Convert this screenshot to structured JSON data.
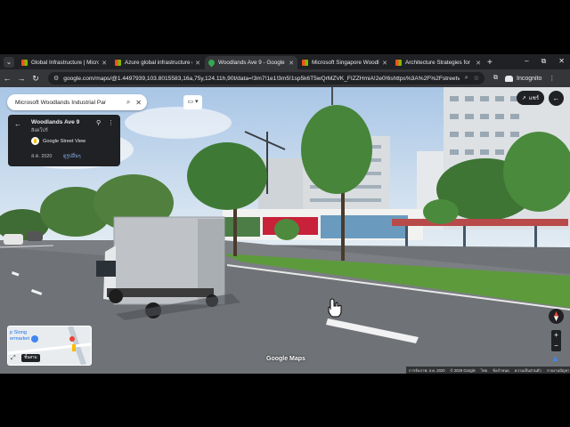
{
  "browser": {
    "tabs": [
      {
        "label": "Global Infrastructure | Micro",
        "favicon": "microsoft-logo-icon",
        "active": false
      },
      {
        "label": "Azure global infrastructure e",
        "favicon": "microsoft-logo-icon",
        "active": false
      },
      {
        "label": "Woodlands Ave 9 - Google",
        "favicon": "google-maps-icon",
        "active": true
      },
      {
        "label": "Microsoft Singapore Woodl",
        "favicon": "microsoft-logo-icon",
        "active": false
      },
      {
        "label": "Architecture Strategies for",
        "favicon": "microsoft-logo-icon",
        "active": false
      }
    ],
    "new_tab": "+",
    "window_controls": {
      "minimize": "–",
      "restore": "⧉",
      "close": "✕"
    },
    "url": "google.com/maps/@1.4497939,103.8015583,16a,75y,124.11h,90t/data=!3m7!1e1!3m5!1sp5k6T5wQrMZVK_FIZZHmiA!2e0!6shttps%3A%2F%2Fstreetviewpi...",
    "profile_label": "Incognito"
  },
  "maps": {
    "search_query": "Microsoft Woodlands Industrial Par",
    "info_card": {
      "title": "Woodlands Ave 9",
      "subtitle": "สิงคโปร์",
      "source": "Google Street View",
      "date": "ส.ค. 2020",
      "see_all": "ดูรูปอื่นๆ"
    },
    "share_label": "แชร์",
    "minimap_text": [
      "p Siong",
      "ermarket"
    ],
    "minimap_chip": "ชั้นสาม",
    "logo": "Google Maps",
    "footer": [
      "การจับภาพ: ส.ค. 2020",
      "© 2026 Google",
      "ไทย",
      "ข้อกำหนด",
      "ความเป็นส่วนตัว",
      "รายงานปัญหา"
    ],
    "zoom_in": "+",
    "zoom_out": "−"
  }
}
